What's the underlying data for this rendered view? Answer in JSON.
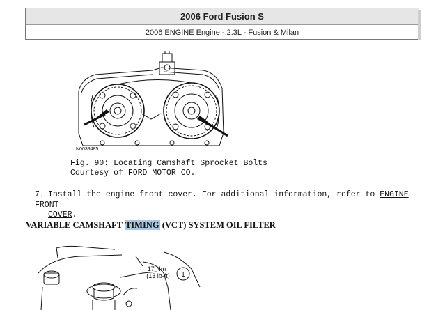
{
  "header": {
    "title": "2006 Ford Fusion S",
    "subtitle": "2006 ENGINE Engine - 2.3L - Fusion & Milan"
  },
  "figure1": {
    "code": "N0039485",
    "caption": "Fig. 90: Locating Camshaft Sprocket Bolts",
    "credit": "Courtesy of FORD MOTOR CO."
  },
  "step7": {
    "number": "7.",
    "text": "Install the engine front cover. For additional information, refer to",
    "link_part1": "ENGINE FRONT",
    "link_part2": "COVER",
    "end": "."
  },
  "section": {
    "prefix": "VARIABLE CAMSHAFT ",
    "highlight": "TIMING",
    "suffix": " (VCT) SYSTEM OIL FILTER"
  },
  "figure2": {
    "torque_nm": "17 Nm",
    "torque_lbft": "(13 lb-ft)",
    "callout": "1"
  }
}
